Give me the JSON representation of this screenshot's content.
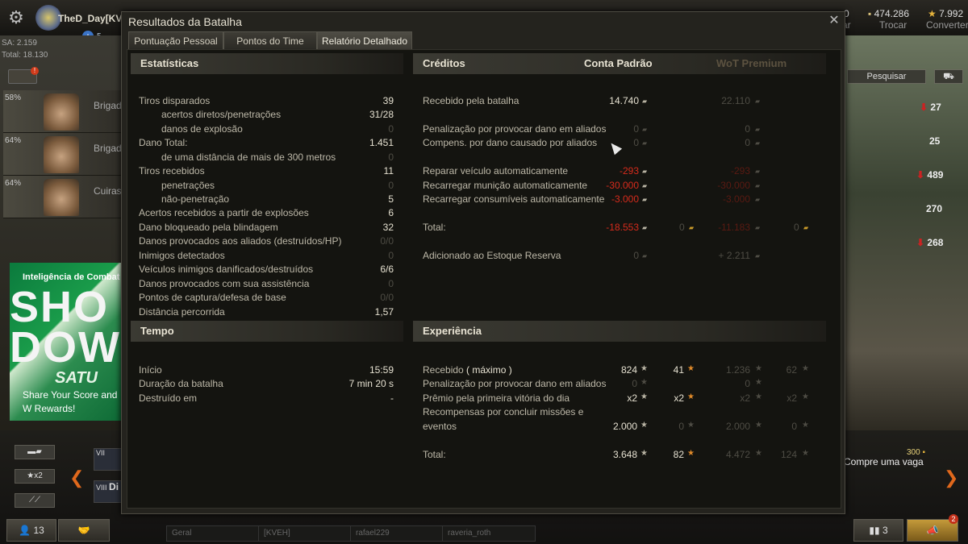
{
  "client": {
    "player_name": "TheD_Day[KVE",
    "plus_count": "5",
    "sa": "SA: 2.159",
    "total": "Total: 18.130",
    "notif_badge": "!",
    "crew": [
      {
        "pct": "58%",
        "rank": "Brigadi"
      },
      {
        "pct": "64%",
        "rank": "Brigadi"
      },
      {
        "pct": "64%",
        "rank": "Cuirass"
      }
    ],
    "banner": {
      "title": "Inteligência de Combat",
      "big": "SHO\nDOW",
      "sub": "SATU",
      "text": "Share Your Score and W Rewards!"
    },
    "resources": {
      "credits": "474.286",
      "credits_label": "Trocar",
      "gold": "7.992",
      "gold_label": "Converter",
      "partial_left": "0",
      "partial_left_label": "rar"
    },
    "search_label": "Pesquisar",
    "right_values": [
      {
        "value": "27",
        "arrow": true
      },
      {
        "value": "25",
        "arrow": false
      },
      {
        "value": "489",
        "arrow": true
      },
      {
        "value": "270",
        "arrow": false
      },
      {
        "value": "268",
        "arrow": true
      }
    ],
    "x2_label": "★x2",
    "tier_labels": [
      "VII",
      "VIII"
    ],
    "tier_partial": "Di",
    "compre_label": "Compre uma vaga",
    "compre_price": "300",
    "bottom": {
      "friends_count": "13",
      "chat_general": "Geral",
      "chat_clan": "[KVEH]",
      "chat_user1": "rafael229",
      "chat_user2": "raveria_roth",
      "stats_count": "3",
      "notif_count": "2"
    }
  },
  "dialog": {
    "title": "Resultados da Batalha",
    "tabs": [
      "Pontuação Pessoal",
      "Pontos do Time",
      "Relatório Detalhado"
    ],
    "stats": {
      "header": "Estatísticas",
      "rows": [
        {
          "label": "Tiros disparados",
          "value": "39",
          "indent": false,
          "dim": false
        },
        {
          "label": "acertos diretos/penetrações",
          "value": "31/28",
          "indent": true,
          "dim": false
        },
        {
          "label": "danos de explosão",
          "value": "0",
          "indent": true,
          "dim": true
        },
        {
          "label": "Dano Total:",
          "value": "1.451",
          "indent": false,
          "dim": false
        },
        {
          "label": "de uma distância de mais de 300 metros",
          "value": "0",
          "indent": true,
          "dim": true
        },
        {
          "label": "Tiros recebidos",
          "value": "11",
          "indent": false,
          "dim": false
        },
        {
          "label": "penetrações",
          "value": "0",
          "indent": true,
          "dim": true
        },
        {
          "label": "não-penetração",
          "value": "5",
          "indent": true,
          "dim": false
        },
        {
          "label": "Acertos recebidos a partir de explosões",
          "value": "6",
          "indent": false,
          "dim": false
        },
        {
          "label": "Dano bloqueado pela blindagem",
          "value": "32",
          "indent": false,
          "dim": false
        },
        {
          "label": "Danos provocados aos aliados (destruídos/HP)",
          "value": "0/0",
          "indent": false,
          "dim": true
        },
        {
          "label": "Inimigos detectados",
          "value": "0",
          "indent": false,
          "dim": true
        },
        {
          "label": "Veículos inimigos danificados/destruídos",
          "value": "6/6",
          "indent": false,
          "dim": false
        },
        {
          "label": "Danos provocados com sua assistência",
          "value": "0",
          "indent": false,
          "dim": true
        },
        {
          "label": "Pontos de captura/defesa de base",
          "value": "0/0",
          "indent": false,
          "dim": true
        },
        {
          "label": "Distância percorrida",
          "value": "1,57",
          "indent": false,
          "dim": false
        }
      ]
    },
    "time": {
      "header": "Tempo",
      "rows": [
        {
          "label": "Início",
          "value": "15:59"
        },
        {
          "label": "Duração da batalha",
          "value": "7 min 20 s"
        },
        {
          "label": "Destruído em",
          "value": "-"
        }
      ]
    },
    "credits": {
      "header": "Créditos",
      "col_standard": "Conta Padrão",
      "col_premium": "WoT Premium",
      "rows": [
        {
          "label": "Recebido pela batalha",
          "std": "14.740",
          "std_style": "val",
          "prem": "22.110",
          "gold1": "",
          "gold2": ""
        },
        {
          "label": "Penalização por provocar dano em aliados",
          "std": "0",
          "std_style": "dim",
          "prem": "0",
          "gold1": "",
          "gold2": ""
        },
        {
          "label": "Compens. por dano causado por aliados",
          "std": "0",
          "std_style": "dim",
          "prem": "0",
          "gold1": "",
          "gold2": ""
        },
        {
          "label": "Reparar veículo automaticamente",
          "std": "-293",
          "std_style": "neg",
          "prem": "-293",
          "gold1": "",
          "gold2": ""
        },
        {
          "label": "Recarregar munição automaticamente",
          "std": "-30.000",
          "std_style": "neg",
          "prem": "-30.000",
          "gold1": "",
          "gold2": ""
        },
        {
          "label": "Recarregar consumíveis automaticamente",
          "std": "-3.000",
          "std_style": "neg",
          "prem": "-3.000",
          "gold1": "",
          "gold2": ""
        },
        {
          "label": "Total:",
          "std": "-18.553",
          "std_style": "neg",
          "prem": "-11.183",
          "gold1": "0",
          "gold2": "0"
        },
        {
          "label": "Adicionado ao Estoque Reserva",
          "std": "0",
          "std_style": "dim",
          "prem": "+ 2.211",
          "gold1": "",
          "gold2": ""
        }
      ]
    },
    "experience": {
      "header": "Experiência",
      "rows": [
        {
          "label": "Recebido",
          "label_extra": "( máximo )",
          "std": "824",
          "free": "41",
          "prem": "1.236",
          "prem_free": "62"
        },
        {
          "label": "Penalização por provocar dano em aliados",
          "label_extra": "",
          "std": "0",
          "free": "",
          "prem": "0",
          "prem_free": ""
        },
        {
          "label": "Prêmio pela primeira vitória do dia",
          "label_extra": "",
          "std": "x2",
          "free": "x2",
          "prem": "x2",
          "prem_free": "x2"
        },
        {
          "label": "Recompensas por concluir missões e",
          "label2": "eventos",
          "label_extra": "",
          "std": "2.000",
          "free": "0",
          "prem": "2.000",
          "prem_free": "0"
        },
        {
          "label": "Total:",
          "label_extra": "",
          "std": "3.648",
          "free": "82",
          "prem": "4.472",
          "prem_free": "124"
        }
      ]
    }
  }
}
